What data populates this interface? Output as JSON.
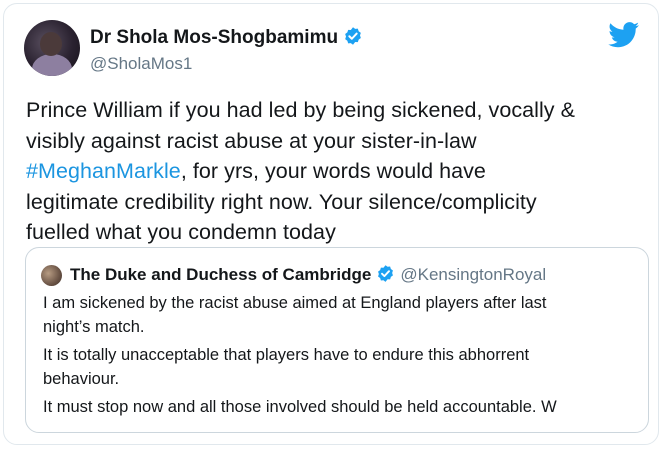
{
  "tweet": {
    "author_name": "Dr Shola Mos-Shogbamimu",
    "author_handle": "@SholaMos1",
    "text_lines": [
      "Prince William if you had led by being sickened, vocally &",
      "visibly against racist abuse at your sister-in-law",
      "#MeghanMarkle",
      ", for yrs, your words would have",
      "legitimate credibility right now.  Your silence/complicity",
      "fuelled what you condemn today"
    ]
  },
  "quoted_tweet": {
    "author_name": "The Duke and Duchess of Cambridge",
    "author_handle": "@KensingtonRoyal",
    "text_lines": [
      "I am sickened by the racist abuse aimed at England players after last",
      "night’s match.",
      "It is totally unacceptable that players have to endure this abhorrent",
      "behaviour.",
      "It must stop now and all those involved should be held accountable. W"
    ]
  },
  "icons": {
    "brand": "twitter-bird-icon",
    "verified": "verified-badge-icon"
  },
  "colors": {
    "link": "#1b95e0",
    "verified": "#1da1f2",
    "handle": "#657786",
    "text": "#14171a"
  }
}
